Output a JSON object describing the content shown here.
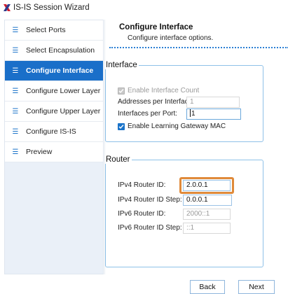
{
  "window": {
    "title": "IS-IS Session Wizard",
    "icon": "x-logo-icon"
  },
  "sidebar": {
    "items": [
      {
        "label": "Select Ports",
        "icon": "list-icon",
        "active": false
      },
      {
        "label": "Select Encapsulation",
        "icon": "list-icon",
        "active": false
      },
      {
        "label": "Configure Interface",
        "icon": "list-icon",
        "active": true
      },
      {
        "label": "Configure Lower Layer",
        "icon": "list-icon",
        "active": false
      },
      {
        "label": "Configure Upper Layer",
        "icon": "list-icon",
        "active": false
      },
      {
        "label": "Configure IS-IS",
        "icon": "list-icon",
        "active": false
      },
      {
        "label": "Preview",
        "icon": "list-icon",
        "active": false
      }
    ]
  },
  "main": {
    "title": "Configure Interface",
    "subtitle": "Configure interface options.",
    "interface_group": {
      "legend": "Interface",
      "enable_interface_count": {
        "label": "Enable Interface Count",
        "checked": true,
        "enabled": false
      },
      "addresses_per_interface": {
        "label": "Addresses per Interface:",
        "value": "1",
        "enabled": false
      },
      "interfaces_per_port": {
        "label": "Interfaces per Port:",
        "value": "1",
        "enabled": true
      },
      "enable_learning_gateway_mac": {
        "label": "Enable Learning Gateway MAC",
        "checked": true,
        "enabled": true
      }
    },
    "router_group": {
      "legend": "Router",
      "ipv4_router_id": {
        "label": "IPv4 Router ID:",
        "value": "2.0.0.1",
        "enabled": true
      },
      "ipv4_router_id_step": {
        "label": "IPv4 Router ID Step:",
        "value": "0.0.0.1",
        "enabled": true
      },
      "ipv6_router_id": {
        "label": "IPv6 Router ID:",
        "value": "2000::1",
        "enabled": false
      },
      "ipv6_router_id_step": {
        "label": "IPv6 Router ID Step:",
        "value": "::1",
        "enabled": false
      }
    }
  },
  "footer": {
    "back_label": "Back",
    "next_label": "Next"
  },
  "colors": {
    "accent": "#1a6fc9",
    "highlight": "#e08a3a",
    "logo": "#d11f2f"
  }
}
